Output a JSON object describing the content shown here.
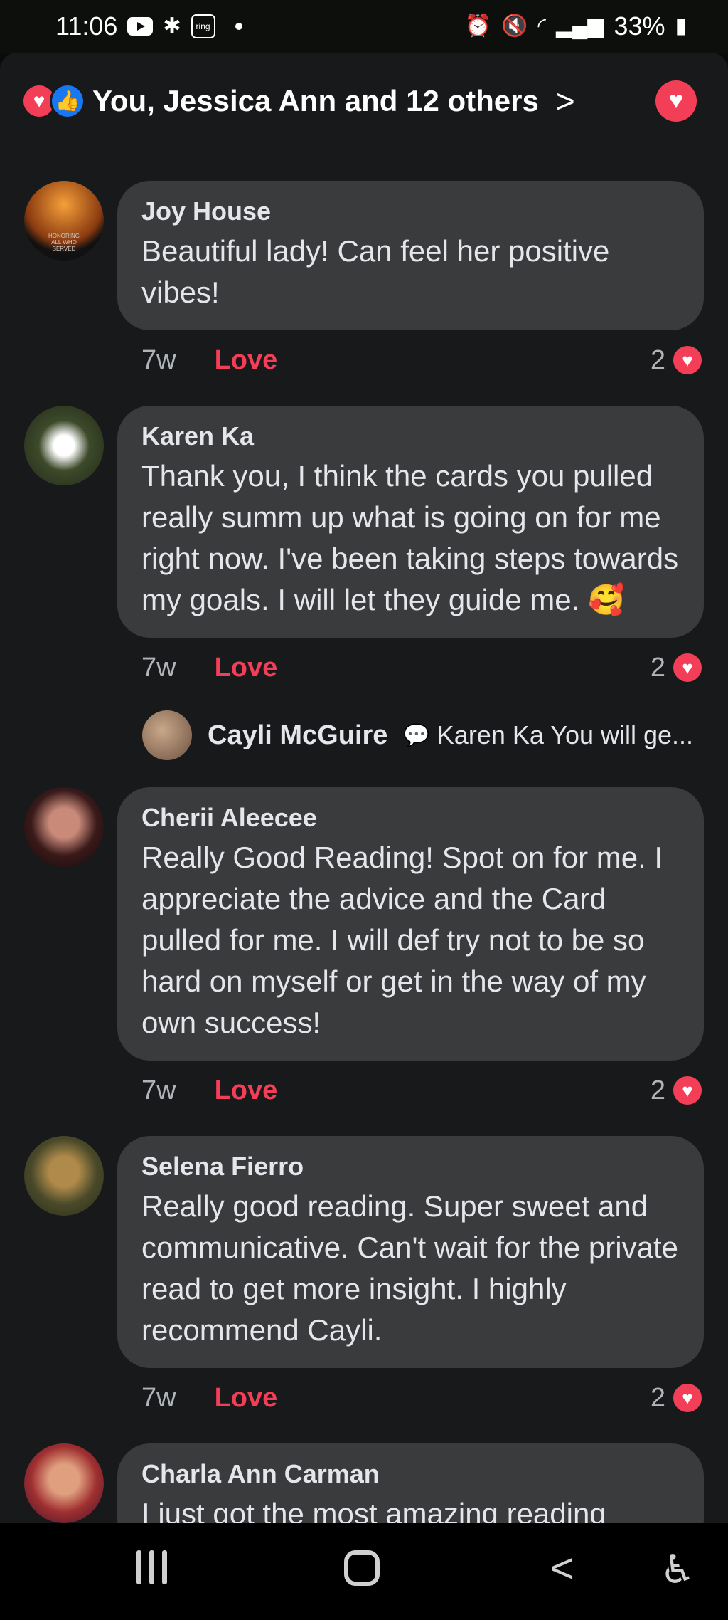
{
  "status_bar": {
    "time": "11:06",
    "battery": "33%",
    "icons": [
      "youtube-icon",
      "gear-icon",
      "ring-icon",
      "alarm-icon",
      "mute-icon",
      "wifi-icon",
      "signal-icon",
      "battery-icon"
    ],
    "ring_label": "ring"
  },
  "reactions": {
    "summary": "You, Jessica Ann and 12 others",
    "icons": [
      "love-reaction-icon",
      "like-reaction-icon"
    ]
  },
  "comments": [
    {
      "name": "Joy House",
      "text": "Beautiful lady! Can feel her positive vibes!",
      "age": "7w",
      "action": "Love",
      "reaction_count": "2",
      "avatar_text": "HONORING ALL WHO SERVED"
    },
    {
      "name": "Karen Ka",
      "text": "Thank you, I think the cards you pulled really summ up what is going on for me right now. I've been taking steps towards my goals. I will let they guide me. 🥰",
      "age": "7w",
      "action": "Love",
      "reaction_count": "2"
    },
    {
      "name": "Cherii Aleecee",
      "text": "Really Good Reading! Spot on for me. I appreciate the advice and the Card pulled for me. I will def try not to be so hard on myself or get in the way of my own success!",
      "age": "7w",
      "action": "Love",
      "reaction_count": "2"
    },
    {
      "name": "Selena Fierro",
      "text": "Really good reading. Super sweet and communicative. Can't wait for the private read to get more insight. I highly recommend Cayli.",
      "age": "7w",
      "action": "Love",
      "reaction_count": "2"
    },
    {
      "name": "Charla Ann Carman",
      "text": "I just got the most amazing reading"
    }
  ],
  "reply_preview": {
    "name": "Cayli McGuire",
    "text": "Karen Ka You will ge..."
  },
  "colors": {
    "accent_love": "#f33e58",
    "like_blue": "#1877f2",
    "bubble": "#3a3b3c",
    "background": "#18191b"
  }
}
